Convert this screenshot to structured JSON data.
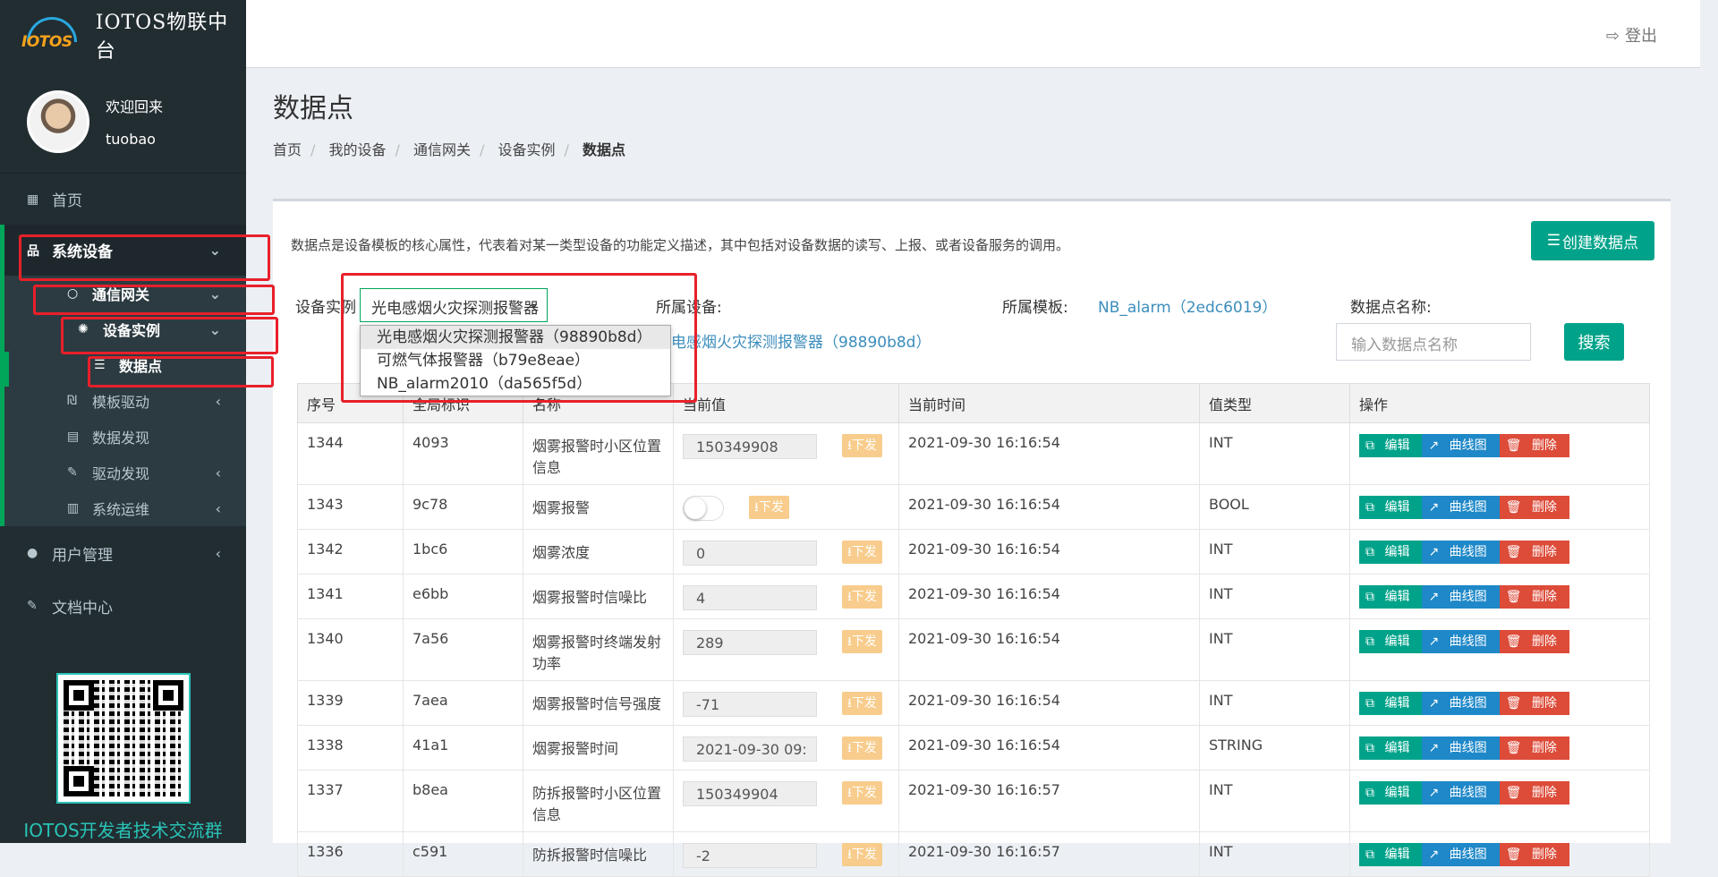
{
  "brand": {
    "logo_text": "IOTOS",
    "name": "IOTOS物联中台"
  },
  "user": {
    "greeting": "欢迎回来",
    "name": "tuobao"
  },
  "menu": {
    "home": "首页",
    "system_devices": "系统设备",
    "gateway": "通信网关",
    "device_instance": "设备实例",
    "data_points": "数据点",
    "template_driver": "模板驱动",
    "data_discovery": "数据发现",
    "driver_discovery": "驱动发现",
    "system_ops": "系统运维",
    "user_mgmt": "用户管理",
    "docs": "文档中心"
  },
  "qr_caption": "IOTOS开发者技术交流群",
  "topbar": {
    "logout": "登出"
  },
  "page": {
    "title": "数据点",
    "breadcrumb": [
      "首页",
      "我的设备",
      "通信网关",
      "设备实例",
      "数据点"
    ]
  },
  "box": {
    "description": "数据点是设备模板的核心属性，代表着对某一类型设备的功能定义描述，其中包括对设备数据的读写、上报、或者设备服务的调用。",
    "create_button": "创建数据点"
  },
  "filters": {
    "instance_label": "设备实例",
    "instance_selected": "光电感烟火灾探测报警器（98890b8d）",
    "instance_options": [
      "光电感烟火灾探测报警器（98890b8d）",
      "可燃气体报警器（b79e8eae）",
      "NB_alarm2010（da565f5d）"
    ],
    "device_label": "所属设备:",
    "device_value": "光电感烟火灾探测报警器（98890b8d）",
    "template_label": "所属模板:",
    "template_value": "NB_alarm（2edc6019）",
    "point_name_label": "数据点名称:",
    "point_name_placeholder": "输入数据点名称",
    "search_button": "搜索"
  },
  "table": {
    "headers": [
      "序号",
      "全局标识",
      "名称",
      "当前值",
      "当前时间",
      "值类型",
      "操作"
    ],
    "send_label": "下发",
    "ops": {
      "edit": "编辑",
      "curve": "曲线图",
      "delete": "删除"
    },
    "rows": [
      {
        "id": "1344",
        "key": "4093",
        "name": "烟雾报警时小区位置信息",
        "value": "150349908",
        "time": "2021-09-30 16:16:54",
        "type": "INT"
      },
      {
        "id": "1343",
        "key": "9c78",
        "name": "烟雾报警",
        "value": "",
        "time": "2021-09-30 16:16:54",
        "type": "BOOL",
        "toggle": true
      },
      {
        "id": "1342",
        "key": "1bc6",
        "name": "烟雾浓度",
        "value": "0",
        "time": "2021-09-30 16:16:54",
        "type": "INT"
      },
      {
        "id": "1341",
        "key": "e6bb",
        "name": "烟雾报警时信噪比",
        "value": "4",
        "time": "2021-09-30 16:16:54",
        "type": "INT"
      },
      {
        "id": "1340",
        "key": "7a56",
        "name": "烟雾报警时终端发射功率",
        "value": "289",
        "time": "2021-09-30 16:16:54",
        "type": "INT"
      },
      {
        "id": "1339",
        "key": "7aea",
        "name": "烟雾报警时信号强度",
        "value": "-71",
        "time": "2021-09-30 16:16:54",
        "type": "INT"
      },
      {
        "id": "1338",
        "key": "41a1",
        "name": "烟雾报警时间",
        "value": "2021-09-30 09:",
        "time": "2021-09-30 16:16:54",
        "type": "STRING"
      },
      {
        "id": "1337",
        "key": "b8ea",
        "name": "防拆报警时小区位置信息",
        "value": "150349904",
        "time": "2021-09-30 16:16:57",
        "type": "INT"
      },
      {
        "id": "1336",
        "key": "c591",
        "name": "防拆报警时信噪比",
        "value": "-2",
        "time": "2021-09-30 16:16:57",
        "type": "INT"
      }
    ]
  }
}
